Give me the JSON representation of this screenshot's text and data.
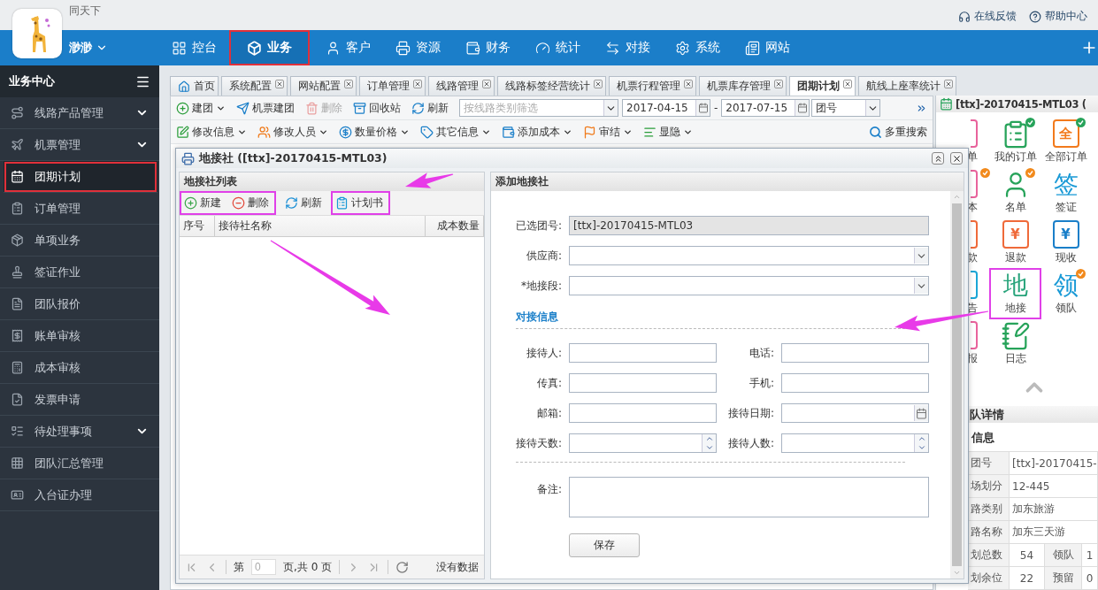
{
  "topbar": {
    "brand": "同天下",
    "links": [
      "在线反馈",
      "帮助中心"
    ]
  },
  "user": {
    "name": "渺渺"
  },
  "nav": [
    {
      "label": "控台",
      "selected": false,
      "annotated": false
    },
    {
      "label": "业务",
      "selected": true,
      "annotated": true
    },
    {
      "label": "客户",
      "selected": false,
      "annotated": false
    },
    {
      "label": "资源",
      "selected": false,
      "annotated": false
    },
    {
      "label": "财务",
      "selected": false,
      "annotated": false
    },
    {
      "label": "统计",
      "selected": false,
      "annotated": false
    },
    {
      "label": "对接",
      "selected": false,
      "annotated": false
    },
    {
      "label": "系统",
      "selected": false,
      "annotated": false
    },
    {
      "label": "网站",
      "selected": false,
      "annotated": false
    }
  ],
  "sidebar": {
    "title": "业务中心",
    "items": [
      {
        "label": "线路产品管理",
        "expandable": true,
        "selected": false,
        "annotated": false
      },
      {
        "label": "机票管理",
        "expandable": true,
        "selected": false,
        "annotated": false
      },
      {
        "label": "团期计划",
        "expandable": false,
        "selected": true,
        "annotated": true
      },
      {
        "label": "订单管理",
        "expandable": false,
        "selected": false,
        "annotated": false
      },
      {
        "label": "单项业务",
        "expandable": false,
        "selected": false,
        "annotated": false
      },
      {
        "label": "签证作业",
        "expandable": false,
        "selected": false,
        "annotated": false
      },
      {
        "label": "团队报价",
        "expandable": false,
        "selected": false,
        "annotated": false
      },
      {
        "label": "账单审核",
        "expandable": false,
        "selected": false,
        "annotated": false
      },
      {
        "label": "成本审核",
        "expandable": false,
        "selected": false,
        "annotated": false
      },
      {
        "label": "发票申请",
        "expandable": false,
        "selected": false,
        "annotated": false
      },
      {
        "label": "待处理事项",
        "expandable": true,
        "selected": false,
        "annotated": false
      },
      {
        "label": "团队汇总管理",
        "expandable": false,
        "selected": false,
        "annotated": false
      },
      {
        "label": "入台证办理",
        "expandable": false,
        "selected": false,
        "annotated": false
      }
    ]
  },
  "tabs": [
    {
      "label": "首页",
      "closable": false,
      "selected": false
    },
    {
      "label": "系统配置",
      "closable": true,
      "selected": false
    },
    {
      "label": "网站配置",
      "closable": true,
      "selected": false
    },
    {
      "label": "订单管理",
      "closable": true,
      "selected": false
    },
    {
      "label": "线路管理",
      "closable": true,
      "selected": false
    },
    {
      "label": "线路标签经营统计",
      "closable": true,
      "selected": false
    },
    {
      "label": "机票行程管理",
      "closable": true,
      "selected": false
    },
    {
      "label": "机票库存管理",
      "closable": true,
      "selected": false
    },
    {
      "label": "团期计划",
      "closable": true,
      "selected": true
    },
    {
      "label": "航线上座率统计",
      "closable": true,
      "selected": false
    }
  ],
  "toolbar": {
    "actions": [
      {
        "label": "建团",
        "dropdown": true,
        "disabled": false
      },
      {
        "label": "机票建团",
        "dropdown": false,
        "disabled": false
      },
      {
        "label": "删除",
        "dropdown": false,
        "disabled": true
      },
      {
        "label": "回收站",
        "dropdown": false,
        "disabled": false
      },
      {
        "label": "刷新",
        "dropdown": false,
        "disabled": false
      }
    ],
    "filter": {
      "placeholder": "按线路类别筛选"
    },
    "date_from": "2017-04-15",
    "date_separator": "-",
    "date_to": "2017-07-15",
    "field": "团号"
  },
  "toolbar2": {
    "actions": [
      {
        "label": "修改信息"
      },
      {
        "label": "修改人员"
      },
      {
        "label": "数量价格"
      },
      {
        "label": "其它信息"
      },
      {
        "label": "添加成本"
      },
      {
        "label": "审结"
      },
      {
        "label": "显隐"
      }
    ],
    "search": "多重搜索"
  },
  "dialog": {
    "title": "地接社 ([ttx]-20170415-MTL03)",
    "list": {
      "title": "地接社列表",
      "actions": [
        {
          "label": "新建",
          "annotated": true
        },
        {
          "label": "删除",
          "annotated": true
        },
        {
          "label": "刷新",
          "annotated": false
        },
        {
          "label": "计划书",
          "annotated": true
        }
      ],
      "columns": [
        "序号",
        "接待社名称",
        "成本数量"
      ],
      "pager": {
        "page_label": "第",
        "page": "0",
        "total": "页,共 0 页",
        "status": "没有数据"
      }
    },
    "form": {
      "title": "添加地接社",
      "top_fields": [
        {
          "label": "已选团号:",
          "kind": "readonly",
          "value": "[ttx]-20170415-MTL03"
        },
        {
          "label": "供应商:",
          "kind": "select"
        },
        {
          "label": "*地接段:",
          "kind": "select"
        }
      ],
      "section": "对接信息",
      "fields": [
        {
          "label": "接待人:",
          "kind": "text"
        },
        {
          "label": "电话:",
          "kind": "text"
        },
        {
          "label": "传真:",
          "kind": "text"
        },
        {
          "label": "手机:",
          "kind": "text"
        },
        {
          "label": "邮箱:",
          "kind": "text"
        },
        {
          "label": "接待日期:",
          "kind": "date"
        },
        {
          "label": "接待天数:",
          "kind": "number"
        },
        {
          "label": "接待人数:",
          "kind": "number"
        }
      ],
      "note": {
        "label": "备注:"
      },
      "save": "保存"
    }
  },
  "group_panel": {
    "title": "[ttx]-20170415-MTL03 (",
    "shortcuts": [
      {
        "label": "单",
        "kind": "symbol",
        "color": "#e8639c",
        "verified": false,
        "pending": false,
        "annotated": false
      },
      {
        "label": "我的订单",
        "kind": "symbol",
        "color": "#27a35a",
        "verified": true,
        "pending": false,
        "annotated": false
      },
      {
        "label": "全部订单",
        "kind": "boxed",
        "glyph": "全",
        "color": "#f27a1c",
        "verified": true,
        "pending": false,
        "annotated": false
      },
      {
        "label": "本",
        "kind": "symbol",
        "color": "#e8639c",
        "verified": false,
        "pending": true,
        "annotated": false
      },
      {
        "label": "名单",
        "kind": "symbol",
        "color": "#27a35a",
        "verified": false,
        "pending": true,
        "annotated": false
      },
      {
        "label": "签证",
        "kind": "glyph",
        "glyph": "签",
        "color": "#1a9ad6",
        "verified": false,
        "pending": false,
        "annotated": false
      },
      {
        "label": "款",
        "kind": "symbol",
        "color": "#ef6a3a",
        "verified": false,
        "pending": false,
        "annotated": false
      },
      {
        "label": "退款",
        "kind": "boxed",
        "glyph": "¥",
        "color": "#ef6a3a",
        "verified": false,
        "pending": false,
        "annotated": false
      },
      {
        "label": "现收",
        "kind": "boxed",
        "glyph": "¥",
        "color": "#1a7fc9",
        "verified": false,
        "pending": false,
        "annotated": false
      },
      {
        "label": "告",
        "kind": "symbol",
        "color": "#1aa6d6",
        "verified": false,
        "pending": false,
        "annotated": false
      },
      {
        "label": "地接",
        "kind": "glyph",
        "glyph": "地",
        "color": "#27a37a",
        "verified": false,
        "pending": false,
        "annotated": true
      },
      {
        "label": "领队",
        "kind": "glyph",
        "glyph": "领",
        "color": "#1a9ad6",
        "verified": false,
        "pending": true,
        "annotated": false
      },
      {
        "label": "报",
        "kind": "symbol",
        "color": "#e8639c",
        "verified": false,
        "pending": false,
        "annotated": false
      },
      {
        "label": "日志",
        "kind": "symbol",
        "color": "#27a35a",
        "verified": false,
        "pending": false,
        "annotated": false
      }
    ],
    "details_title": "队详情",
    "info_title": "信息",
    "rows": [
      [
        "团号",
        "[ttx]-20170415-"
      ],
      [
        "场划分",
        "12-445"
      ],
      [
        "路类别",
        "加东旅游"
      ],
      [
        "路名称",
        "加东三天游"
      ],
      [
        "划总数",
        "54",
        "领队",
        "1"
      ],
      [
        "划余位",
        "22",
        "预留",
        "0"
      ]
    ]
  }
}
